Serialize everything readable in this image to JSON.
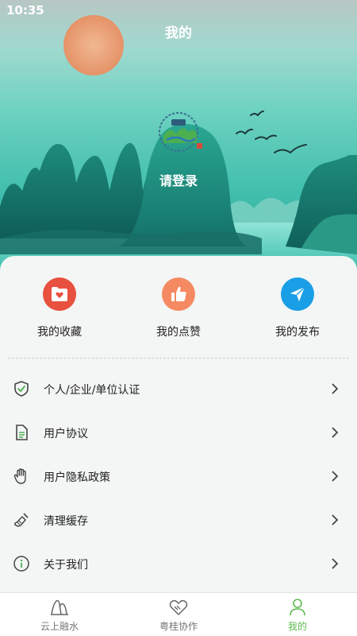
{
  "status_bar": {
    "time": "10:35"
  },
  "header": {
    "title": "我的"
  },
  "profile": {
    "login_text": "请登录"
  },
  "quick_actions": [
    {
      "label": "我的收藏",
      "icon": "favorites-folder-icon",
      "color": "#e8503f"
    },
    {
      "label": "我的点赞",
      "icon": "thumbs-up-icon",
      "color": "#f58a62"
    },
    {
      "label": "我的发布",
      "icon": "send-icon",
      "color": "#1a9ee6"
    }
  ],
  "menu": [
    {
      "label": "个人/企业/单位认证",
      "icon": "shield-check-icon"
    },
    {
      "label": "用户协议",
      "icon": "document-icon"
    },
    {
      "label": "用户隐私政策",
      "icon": "hand-icon"
    },
    {
      "label": "清理缓存",
      "icon": "broom-icon"
    },
    {
      "label": "关于我们",
      "icon": "info-icon"
    }
  ],
  "tabs": [
    {
      "label": "云上融水",
      "icon": "mountain-icon",
      "active": false
    },
    {
      "label": "粤桂协作",
      "icon": "handshake-heart-icon",
      "active": false
    },
    {
      "label": "我的",
      "icon": "person-icon",
      "active": true
    }
  ],
  "colors": {
    "accent_green": "#5dba4f",
    "hero_teal": "#43bfae"
  }
}
